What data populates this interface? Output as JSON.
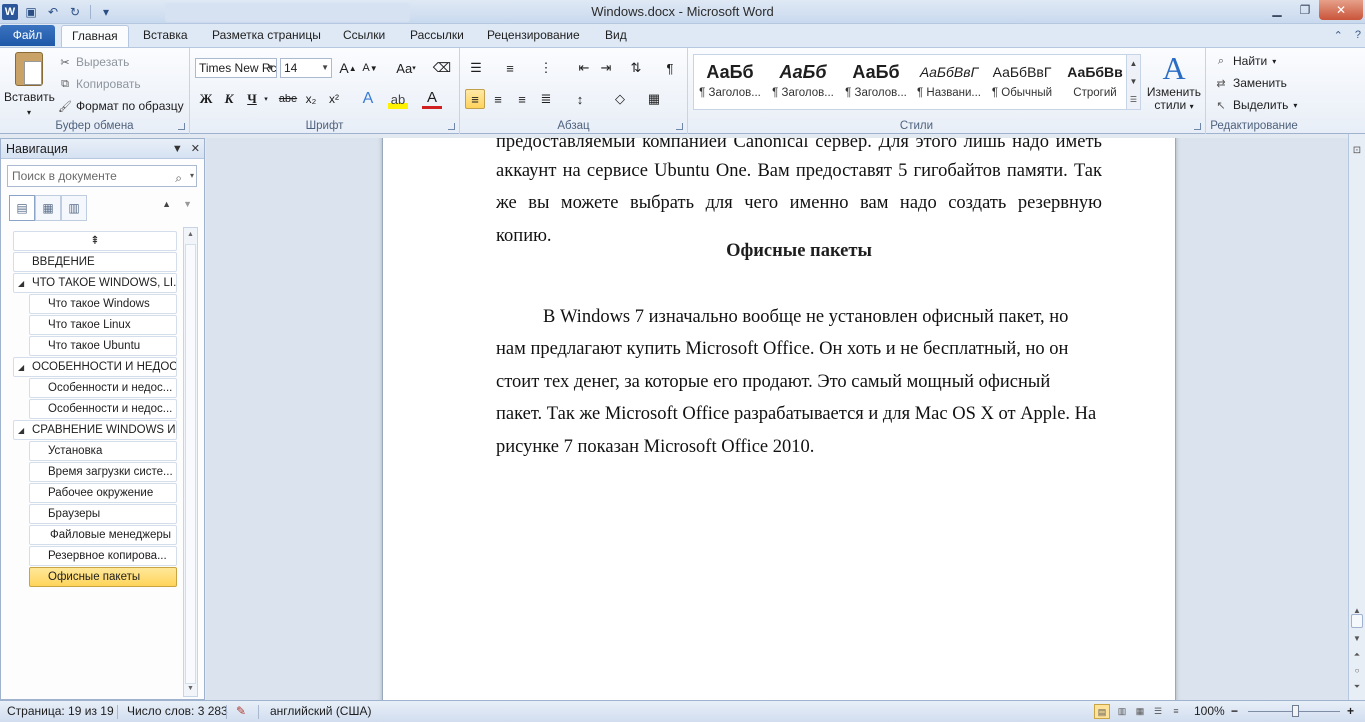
{
  "window": {
    "title": "Windows.docx - Microsoft Word",
    "app_logo": "W",
    "qat_icons": [
      "save-icon",
      "undo-icon",
      "redo-icon",
      "customize-icon"
    ]
  },
  "ribbon_tabs": [
    "Файл",
    "Главная",
    "Вставка",
    "Разметка страницы",
    "Ссылки",
    "Рассылки",
    "Рецензирование",
    "Вид"
  ],
  "active_tab": "Главная",
  "clipboard": {
    "paste": "Вставить",
    "cut": "Вырезать",
    "copy": "Копировать",
    "format_painter": "Формат по образцу",
    "label": "Буфер обмена"
  },
  "font": {
    "name": "Times New Rc",
    "size": "14",
    "grow": "A",
    "shrink": "A",
    "case": "Aa",
    "bold": "Ж",
    "italic": "К",
    "underline": "Ч",
    "strike": "abe",
    "subscript": "x₂",
    "superscript": "x²",
    "label": "Шрифт"
  },
  "paragraph": {
    "label": "Абзац",
    "pilcrow": "¶"
  },
  "styles": {
    "items": [
      {
        "sample": "АаБб",
        "name": "¶ Заголов..."
      },
      {
        "sample": "АаБб",
        "name": "¶ Заголов..."
      },
      {
        "sample": "АаБб",
        "name": "¶ Заголов..."
      },
      {
        "sample": "АаБбВвГ",
        "name": "¶ Названи..."
      },
      {
        "sample": "АаБбВвГ",
        "name": "¶ Обычный"
      },
      {
        "sample": "АаБбВв",
        "name": "Строгий"
      }
    ],
    "change_styles_line1": "Изменить",
    "change_styles_line2": "стили",
    "label": "Стили"
  },
  "editing": {
    "find": "Найти",
    "replace": "Заменить",
    "select": "Выделить",
    "label": "Редактирование"
  },
  "navigation": {
    "title": "Навигация",
    "search_placeholder": "Поиск в документе",
    "items": [
      {
        "label": "ВВЕДЕНИЕ",
        "level": 1,
        "expandable": false
      },
      {
        "label": "ЧТО ТАКОЕ WINDOWS, LI...",
        "level": 1,
        "expandable": true
      },
      {
        "label": "Что такое Windows",
        "level": 2
      },
      {
        "label": "Что такое Linux",
        "level": 2
      },
      {
        "label": "Что такое Ubuntu",
        "level": 2
      },
      {
        "label": "ОСОБЕННОСТИ И НЕДОС...",
        "level": 1,
        "expandable": true
      },
      {
        "label": "Особенности и недос...",
        "level": 2
      },
      {
        "label": "Особенности и недос...",
        "level": 2
      },
      {
        "label": "СРАВНЕНИЕ WINDOWS И...",
        "level": 1,
        "expandable": true
      },
      {
        "label": "Установка",
        "level": 2
      },
      {
        "label": "Время загрузки систе...",
        "level": 2
      },
      {
        "label": "Рабочее окружение",
        "level": 2
      },
      {
        "label": "Браузеры",
        "level": 2
      },
      {
        "label": "Файловые менеджеры",
        "level": 2
      },
      {
        "label": "Резервное копирова...",
        "level": 2
      },
      {
        "label": "Офисные пакеты",
        "level": 2,
        "selected": true
      }
    ]
  },
  "document": {
    "cut_line": "предоставляемый компанией Canonical сервер. Для этого лишь надо иметь",
    "para1_lines": [
      "аккаунт на сервисе Ubuntu One. Вам предоставят 5 гигобайтов памяти. Так",
      "же вы можете выбрать для чего именно вам надо создать резервную"
    ],
    "para1_last": "копию.",
    "heading": "Офисные пакеты",
    "para2_lines": [
      "В Windows 7 изначально вообще не установлен офисный пакет, но",
      "нам предлагают купить Microsoft Office. Он хоть и не бесплатный, но он",
      "стоит тех денег, за которые его продают. Это самый мощный офисный",
      "пакет. Так же Microsoft Office разрабатывается и для Mac OS X от Apple. На",
      "рисунке 7 показан Microsoft Office 2010."
    ]
  },
  "status": {
    "page": "Страница: 19 из 19",
    "words": "Число слов: 3 283",
    "language": "английский (США)",
    "zoom": "100%",
    "zoom_minus": "−",
    "zoom_plus": "+"
  }
}
